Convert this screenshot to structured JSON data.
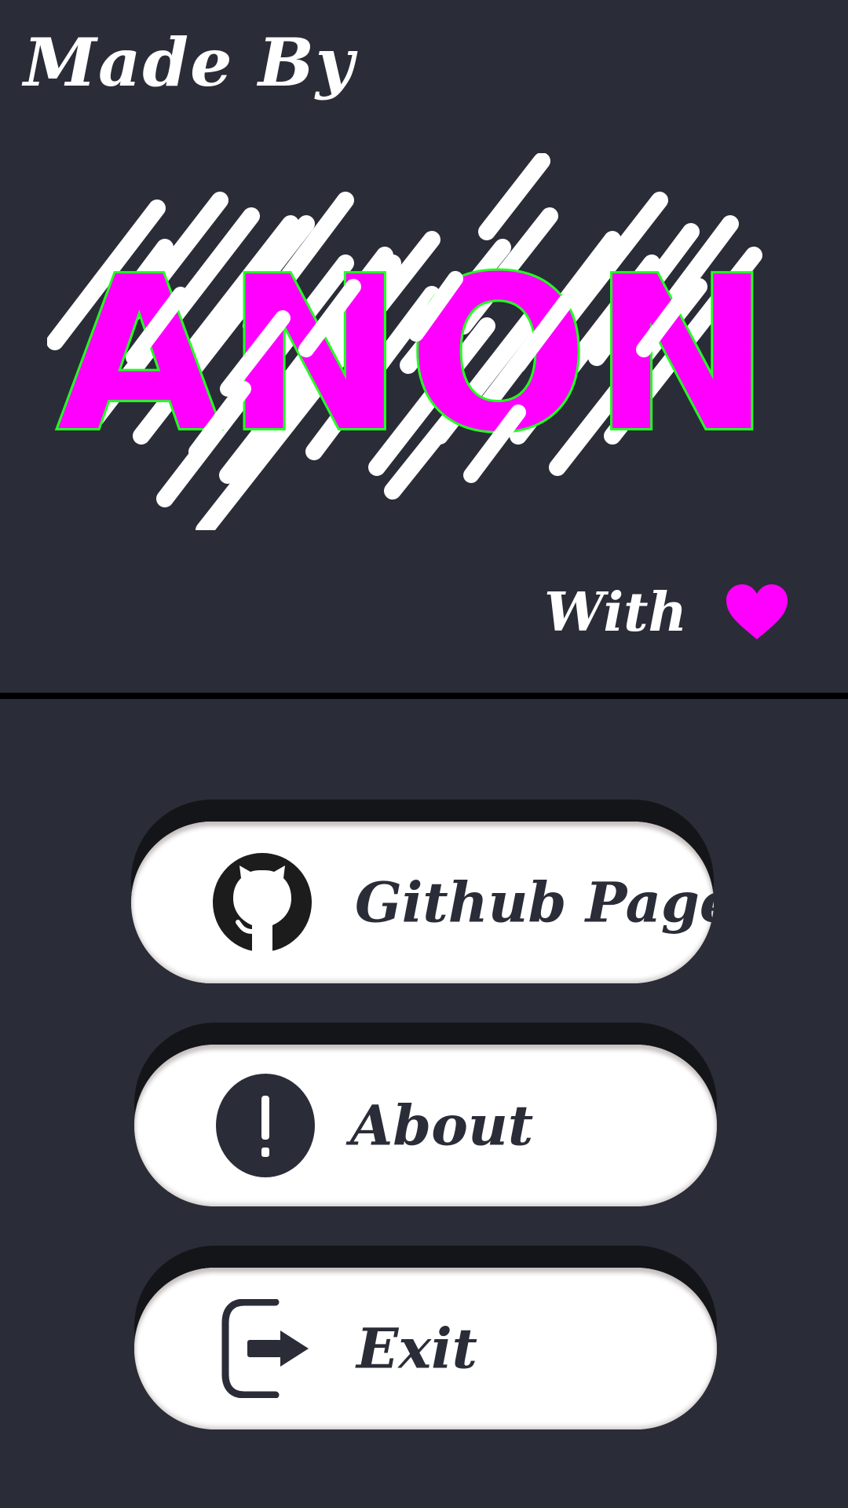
{
  "header": {
    "made_by": "Made By",
    "logo_text": "ANON",
    "with_text": "With",
    "heart_icon": "heart-icon"
  },
  "colors": {
    "background": "#2a2d37",
    "logo_fill": "#ff00ff",
    "logo_outline": "#22ff22",
    "heart": "#ff00ff",
    "divider": "#000000",
    "button_fill": "#ffffff",
    "button_shadow": "#141519"
  },
  "menu": [
    {
      "label": "Github Page",
      "icon": "github-icon"
    },
    {
      "label": "About",
      "icon": "info-icon"
    },
    {
      "label": "Exit",
      "icon": "exit-icon"
    }
  ]
}
